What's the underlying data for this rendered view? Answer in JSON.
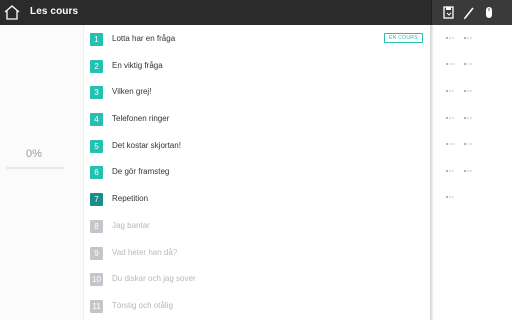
{
  "header": {
    "title": "Les cours",
    "icons": [
      "home-icon",
      "save-icon",
      "pencil-icon",
      "mouse-icon"
    ]
  },
  "progress": {
    "label": "0%",
    "value": 0
  },
  "lessons": [
    {
      "number": "1",
      "title": "Lotta har en fråga",
      "state": "done",
      "status": "EN COURS"
    },
    {
      "number": "2",
      "title": "En viktig fråga",
      "state": "done"
    },
    {
      "number": "3",
      "title": "Vilken grej!",
      "state": "done"
    },
    {
      "number": "4",
      "title": "Telefonen ringer",
      "state": "done"
    },
    {
      "number": "5",
      "title": "Det kostar skjortan!",
      "state": "done"
    },
    {
      "number": "6",
      "title": "De gör framsteg",
      "state": "done"
    },
    {
      "number": "7",
      "title": "Repetition",
      "state": "review"
    },
    {
      "number": "8",
      "title": "Jag bantar",
      "state": "locked"
    },
    {
      "number": "9",
      "title": "Vad heter han då?",
      "state": "locked"
    },
    {
      "number": "10",
      "title": "Du diskar och jag sover",
      "state": "locked"
    },
    {
      "number": "11",
      "title": "Törstig och otålig",
      "state": "locked"
    }
  ],
  "colors": {
    "done": "#25c0b0",
    "review": "#178f86",
    "locked": "#c3c7cc",
    "text_active": "#333333",
    "text_locked": "#b5b8bc"
  }
}
